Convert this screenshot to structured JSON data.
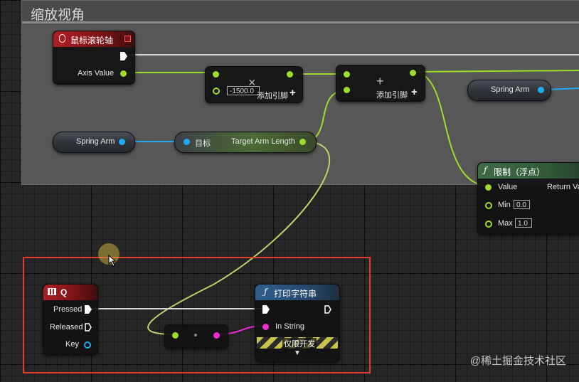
{
  "comment": {
    "title": "缩放视角"
  },
  "mouse_wheel_node": {
    "title": "鼠标滚轮轴",
    "axis_value_label": "Axis Value"
  },
  "multiply_node": {
    "value": "-1500.0",
    "symbol": "×",
    "add_pin_label": "添加引脚"
  },
  "add_node": {
    "symbol": "+",
    "add_pin_label": "添加引脚"
  },
  "spring_arm_var_top": {
    "label": "Spring Arm"
  },
  "spring_arm_var_left": {
    "label": "Spring Arm"
  },
  "target_arm_length_node": {
    "target_label": "目标",
    "output_label": "Target Arm Length"
  },
  "clamp_node": {
    "title": "限制（浮点）",
    "value_label": "Value",
    "return_label": "Return Va",
    "min_label": "Min",
    "min_value": "0.0",
    "max_label": "Max",
    "max_value": "1.0"
  },
  "q_key_node": {
    "title": "Q",
    "pressed_label": "Pressed",
    "released_label": "Released",
    "key_label": "Key"
  },
  "print_string_node": {
    "title": "打印字符串",
    "in_string_label": "In String",
    "dev_only_label": "仅限开发"
  },
  "watermark": "@稀土掘金技术社区",
  "colors": {
    "float_pin": "#9cdd2c",
    "object_pin": "#22a8f0",
    "string_pin": "#f02ad4",
    "selection": "#e53a30"
  }
}
